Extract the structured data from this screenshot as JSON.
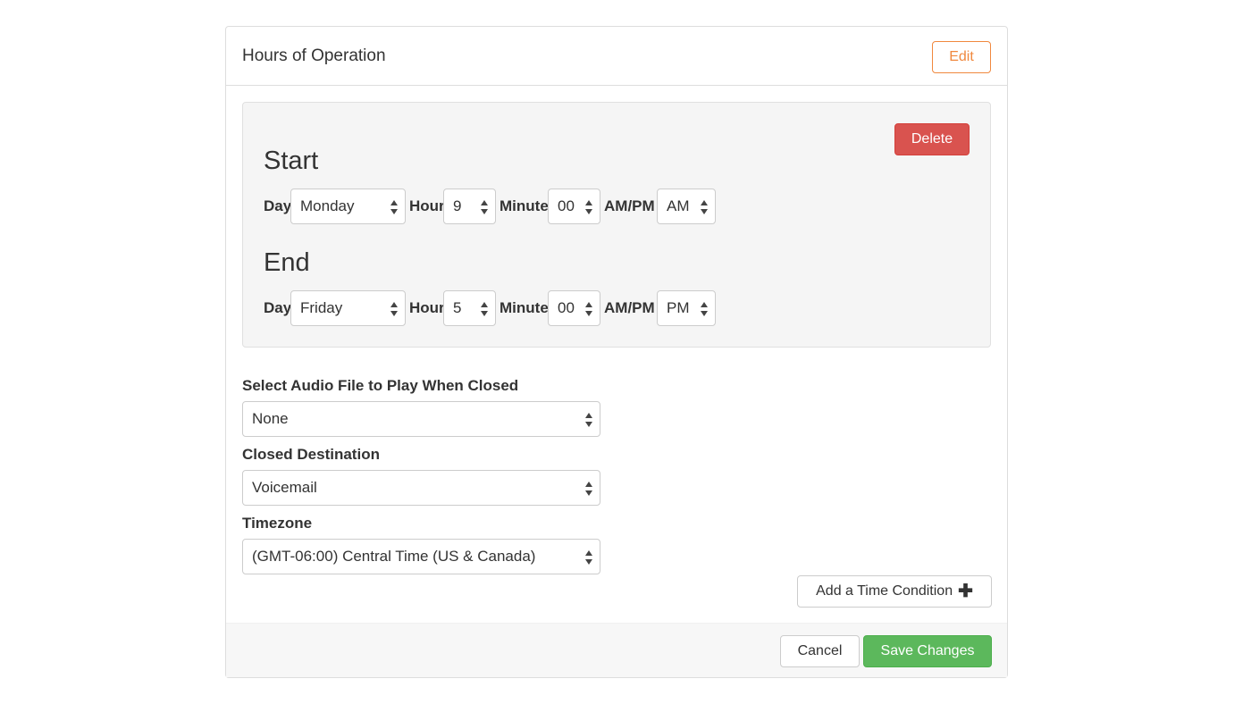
{
  "panel": {
    "title": "Hours of Operation",
    "edit_label": "Edit"
  },
  "condition": {
    "delete_label": "Delete",
    "start": {
      "heading": "Start",
      "day_label": "Day",
      "day": "Monday",
      "hour_label": "Hour",
      "hour": "9",
      "minute_label": "Minute",
      "minute": "00",
      "ampm_label": "AM/PM",
      "ampm": "AM"
    },
    "end": {
      "heading": "End",
      "day_label": "Day",
      "day": "Friday",
      "hour_label": "Hour",
      "hour": "5",
      "minute_label": "Minute",
      "minute": "00",
      "ampm_label": "AM/PM",
      "ampm": "PM"
    }
  },
  "fields": {
    "audio_label": "Select Audio File to Play When Closed",
    "audio_value": "None",
    "destination_label": "Closed Destination",
    "destination_value": "Voicemail",
    "timezone_label": "Timezone",
    "timezone_value": "(GMT-06:00) Central Time (US & Canada)"
  },
  "actions": {
    "add_condition_label": "Add a Time Condition",
    "add_icon": "plus-icon",
    "cancel_label": "Cancel",
    "save_label": "Save Changes"
  },
  "colors": {
    "edit": "#f0883e",
    "delete": "#d9534f",
    "save": "#5cb85c"
  }
}
